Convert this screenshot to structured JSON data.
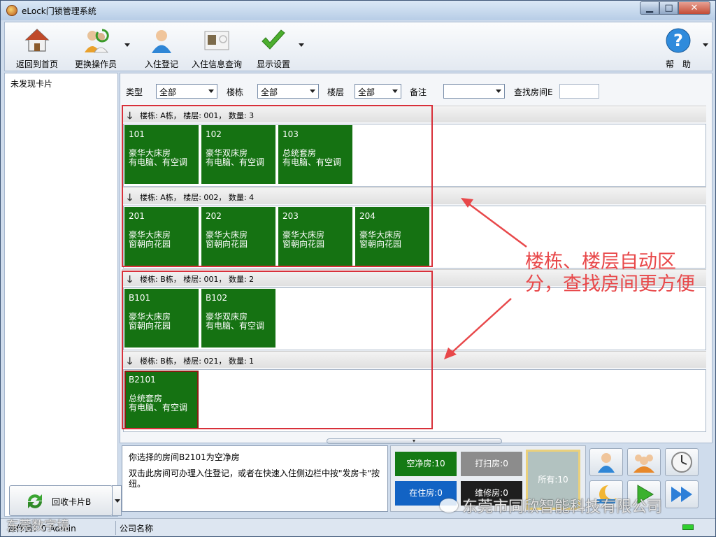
{
  "window": {
    "title": "eLock门锁管理系统"
  },
  "toolbar": {
    "home": "返回到首页",
    "switch_operator": "更换操作员",
    "checkin": "入住登记",
    "checkin_query": "入住信息查询",
    "display_settings": "显示设置",
    "help": "帮　助"
  },
  "left": {
    "no_card": "未发现卡片",
    "recycle_btn": "回收卡片B"
  },
  "filters": {
    "type_label": "类型",
    "type_value": "全部",
    "building_label": "楼栋",
    "building_value": "全部",
    "floor_label": "楼层",
    "floor_value": "全部",
    "remark_label": "备注",
    "remark_value": "",
    "search_label": "查找房间E",
    "search_value": ""
  },
  "groups": [
    {
      "header": "楼栋: A栋，  楼层: 001，  数量: 3",
      "rooms": [
        {
          "no": "101",
          "l1": "豪华大床房",
          "l2": "有电脑、有空调"
        },
        {
          "no": "102",
          "l1": "豪华双床房",
          "l2": "有电脑、有空调"
        },
        {
          "no": "103",
          "l1": "总统套房",
          "l2": "有电脑、有空调"
        }
      ]
    },
    {
      "header": "楼栋: A栋，  楼层: 002，  数量: 4",
      "rooms": [
        {
          "no": "201",
          "l1": "豪华大床房",
          "l2": "窗朝向花园"
        },
        {
          "no": "202",
          "l1": "豪华大床房",
          "l2": "窗朝向花园"
        },
        {
          "no": "203",
          "l1": "豪华大床房",
          "l2": "窗朝向花园"
        },
        {
          "no": "204",
          "l1": "豪华大床房",
          "l2": "窗朝向花园"
        }
      ]
    },
    {
      "header": "楼栋: B栋，  楼层: 001，  数量: 2",
      "rooms": [
        {
          "no": "B101",
          "l1": "豪华大床房",
          "l2": "窗朝向花园"
        },
        {
          "no": "B102",
          "l1": "豪华双床房",
          "l2": "有电脑、有空调"
        }
      ]
    },
    {
      "header": "楼栋: B栋，  楼层: 021，  数量: 1",
      "rooms": [
        {
          "no": "B2101",
          "l1": "总统套房",
          "l2": "有电脑、有空调"
        }
      ]
    }
  ],
  "annotation": {
    "line1": "楼栋、楼层自动区",
    "line2": "分，查找房间更方便"
  },
  "info": {
    "line1": "你选择的房间B2101为空净房",
    "line2": "双击此房间可办理入住登记，或者在快速入住侧边栏中按\"发房卡\"按纽。"
  },
  "status": {
    "vacant_clean": "空净房:10",
    "cleaning": "打扫房:0",
    "occupied": "在住房:0",
    "repair": "维修房:0",
    "all": "所有:10"
  },
  "colors": {
    "room_green": "#157212",
    "vacant_green": "#147a14",
    "cleaning_gray": "#8c8c8c",
    "occupied_blue": "#1263c4",
    "repair_black": "#1e1e1e",
    "annotation_red": "#e8484a"
  },
  "icons": {
    "home": "house-icon",
    "switch_operator": "users-swap-icon",
    "checkin": "person-icon",
    "checkin_query": "id-card-icon",
    "display_settings": "checkmark-icon",
    "help": "question-icon",
    "recycle": "recycle-icon",
    "actions": [
      "person-icon",
      "group-icon",
      "clock-icon",
      "night-icon",
      "play-icon",
      "skip-forward-icon"
    ]
  },
  "statusbar": {
    "operator": "操作员：0 Admin",
    "company": "公司名称"
  },
  "watermark": {
    "left": "东莞数字境",
    "right": "东莞市同欣智能科技有限公司"
  }
}
